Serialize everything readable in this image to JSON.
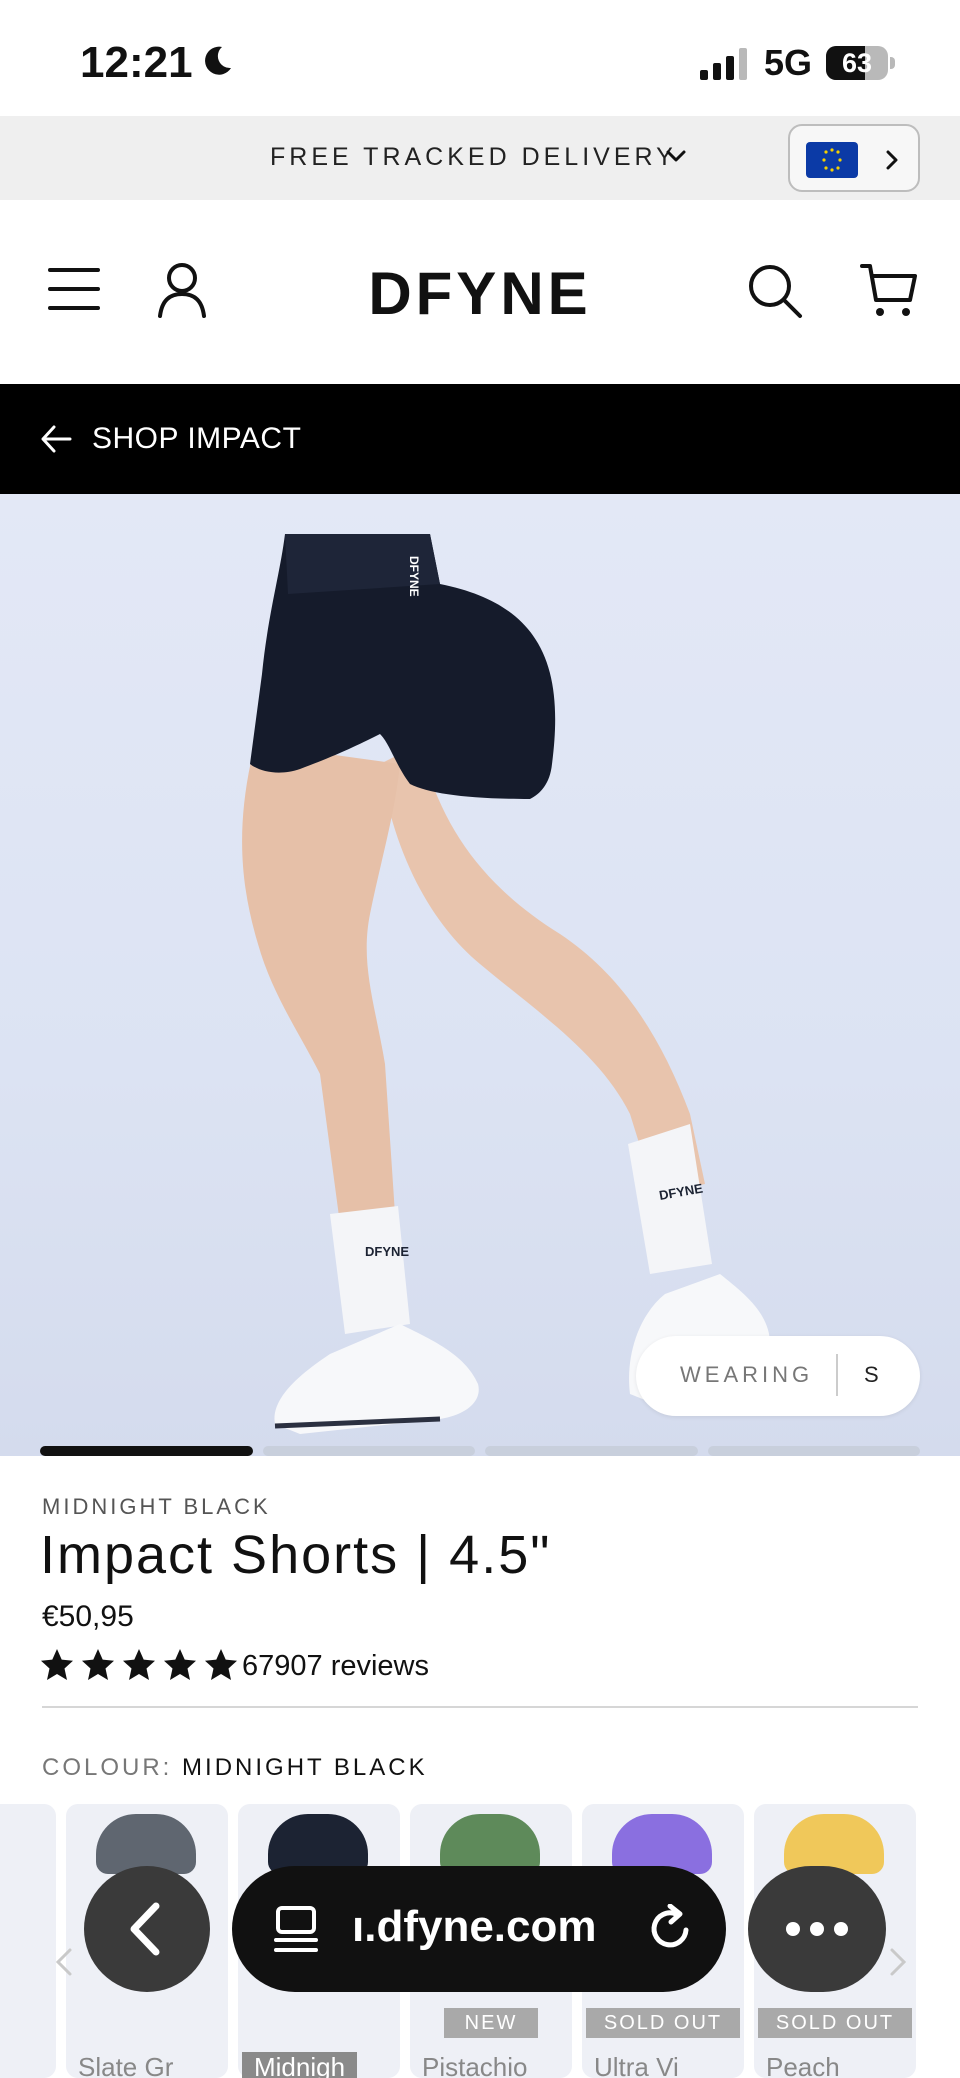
{
  "status_bar": {
    "time": "12:21",
    "network": "5G",
    "battery_text": "63",
    "battery_level": 0.63,
    "icons": [
      "moon-icon",
      "signal-icon",
      "battery-icon"
    ]
  },
  "promo_bar": {
    "text": "FREE TRACKED DELIVERY",
    "icon": "chevron-down-icon",
    "region_icon": "eu-flag-icon"
  },
  "header": {
    "logo_text": "DFYNE",
    "icons": [
      "menu-icon",
      "account-icon",
      "search-icon",
      "cart-icon"
    ]
  },
  "back_bar": {
    "label": "SHOP IMPACT"
  },
  "gallery": {
    "wearing_label": "WEARING",
    "wearing_size": "S",
    "image_count": 4,
    "active_index": 0
  },
  "product": {
    "variant": "MIDNIGHT BLACK",
    "title": "Impact Shorts | 4.5\"",
    "price": "€50,95",
    "rating": 5,
    "reviews": "67907 reviews",
    "colour_label": "COLOUR:",
    "colour_value": "MIDNIGHT BLACK"
  },
  "swatches": [
    {
      "name": "Slate Gr",
      "color": "#5f6670",
      "badge": "",
      "selected": false
    },
    {
      "name": "Midnigh",
      "color": "#1c2333",
      "badge": "",
      "selected": true
    },
    {
      "name": "Pistachio",
      "color": "#5e8a5a",
      "badge": "NEW",
      "selected": false
    },
    {
      "name": "Ultra Vi",
      "color": "#8a6fe0",
      "badge": "SOLD OUT",
      "selected": false
    },
    {
      "name": "Peach",
      "color": "#f0c85a",
      "badge": "SOLD OUT",
      "selected": false
    }
  ],
  "browser": {
    "url": "ı.dfyne.com",
    "icons": [
      "back-arrow-icon",
      "tabs-icon",
      "reload-icon",
      "more-icon"
    ]
  },
  "colors": {
    "black": "#000000",
    "promo_bg": "#efefef",
    "hero_bg": "#dce3f3",
    "progress_active": "#111111",
    "progress_inactive": "#c8cfdc"
  }
}
